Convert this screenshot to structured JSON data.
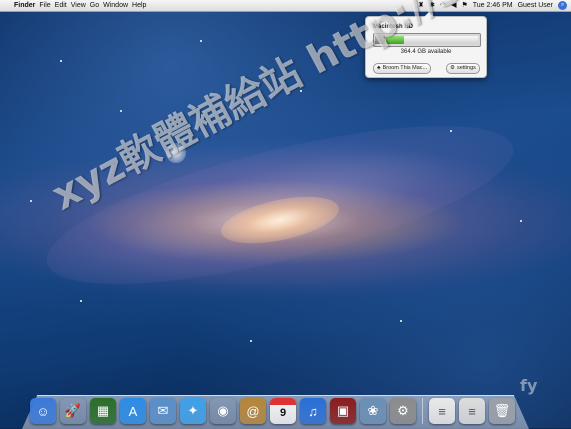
{
  "menubar": {
    "apple_icon": "apple-icon",
    "app_name": "Finder",
    "menus": [
      "File",
      "Edit",
      "View",
      "Go",
      "Window",
      "Help"
    ],
    "clock": "Tue 2:46 PM",
    "user": "Guest User",
    "tray_icons": [
      "disk-broom-icon",
      "bluetooth-icon",
      "wifi-icon",
      "volume-icon",
      "flag-icon",
      "spotlight-icon"
    ]
  },
  "popup": {
    "disk_name": "Macintosh HD",
    "used_fraction": 0.2,
    "available_text": "364.4 GB available",
    "broom_button": "Broom This Mac...",
    "settings_button": "settings",
    "colors": {
      "bar_fill": "#3aa21a"
    }
  },
  "watermark": {
    "text": "xyz軟體補給站 http://31.to",
    "corner_text": "fy"
  },
  "dock": {
    "items": [
      {
        "name": "finder-icon",
        "glyph": "☺",
        "color": "#3b7ad9"
      },
      {
        "name": "launchpad-icon",
        "glyph": "🚀",
        "color": "#555"
      },
      {
        "name": "mission-control-icon",
        "glyph": "▦",
        "color": "#2a6e2a"
      },
      {
        "name": "app-store-icon",
        "glyph": "A",
        "color": "#2d8ce6"
      },
      {
        "name": "mail-icon",
        "glyph": "✉",
        "color": "#5a8fc9"
      },
      {
        "name": "safari-icon",
        "glyph": "✦",
        "color": "#3fa0e8"
      },
      {
        "name": "facetime-icon",
        "glyph": "◉",
        "color": "#666"
      },
      {
        "name": "address-book-icon",
        "glyph": "@",
        "color": "#b7863b"
      },
      {
        "name": "ical-icon",
        "glyph": "",
        "color": "#f4f4f4",
        "calendar_day": "9"
      },
      {
        "name": "itunes-icon",
        "glyph": "♫",
        "color": "#2a6fd6"
      },
      {
        "name": "photo-booth-icon",
        "glyph": "▣",
        "color": "#8a1d1d"
      },
      {
        "name": "iphoto-icon",
        "glyph": "❀",
        "color": "#6b8fb5"
      },
      {
        "name": "system-preferences-icon",
        "glyph": "⚙",
        "color": "#8c8c8c"
      },
      {
        "name": "documents-stack-icon",
        "glyph": "≡",
        "color": "#e9e9e9"
      },
      {
        "name": "downloads-stack-icon",
        "glyph": "≡",
        "color": "#dcdcdc"
      },
      {
        "name": "trash-icon",
        "glyph": "🗑",
        "color": "#9aa0a8"
      }
    ]
  }
}
